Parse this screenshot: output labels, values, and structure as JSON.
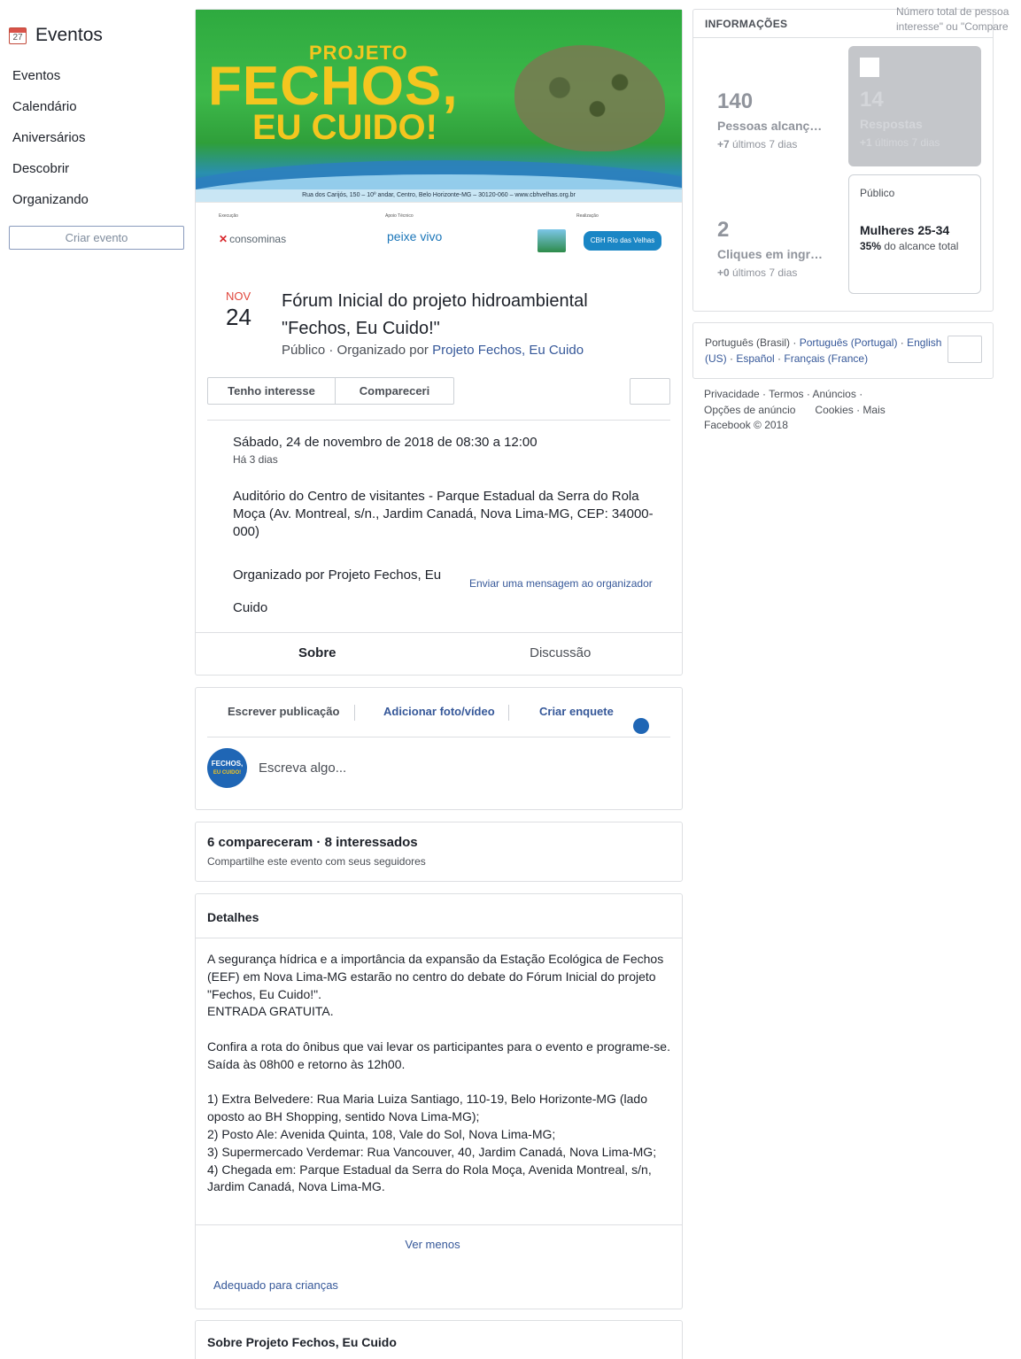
{
  "sidebar": {
    "title": "Eventos",
    "calendar_icon_day": "27",
    "nav": [
      "Eventos",
      "Calendário",
      "Aniversários",
      "Descobrir",
      "Organizando"
    ],
    "create_button": "Criar evento"
  },
  "cover": {
    "title_line1": "PROJETO",
    "title_line2": "FECHOS,",
    "title_line3": "EU CUIDO!",
    "address_strip": "Rua dos Carijós, 150 – 10º andar, Centro, Belo Horizonte-MG – 30120-060 – www.cbhvelhas.org.br",
    "logo_label_1": "Execução",
    "logo_label_2": "Apoio Técnico",
    "logo_label_3": "Realização",
    "logo_1": "consominas",
    "logo_2": "peixe vivo",
    "logo_4": "CBH Rio das Velhas"
  },
  "event": {
    "month": "NOV",
    "day": "24",
    "title": "Fórum Inicial do projeto hidroambiental \"Fechos, Eu Cuido!\"",
    "privacy": "Público · Organizado por",
    "organizer": "Projeto Fechos, Eu Cuido",
    "interested_button": "Tenho interesse",
    "attended_button": "Compareceri",
    "datetime": "Sábado, 24 de novembro de 2018 de 08:30 a 12:00",
    "relative_time": "Há 3 dias",
    "location": "Auditório do Centro de visitantes - Parque Estadual da Serra do Rola Moça (Av. Montreal, s/n., Jardim Canadá, Nova Lima-MG, CEP: 34000-000)",
    "organized_by_line1": "Organizado por Projeto Fechos, Eu",
    "organized_by_line2": "Cuido",
    "message_link": "Enviar uma mensagem ao organizador",
    "tab_about": "Sobre",
    "tab_discussion": "Discussão"
  },
  "composer": {
    "tab_write": "Escrever publicação",
    "tab_photo": "Adicionar foto/vídeo",
    "tab_poll": "Criar enquete",
    "placeholder": "Escreva algo...",
    "avatar_text1": "FECHOS,",
    "avatar_text2": "EU CUIDO!"
  },
  "attendance": {
    "summary": "6 compareceram · 8 interessados",
    "subtitle": "Compartilhe este evento com seus seguidores"
  },
  "details": {
    "heading": "Detalhes",
    "paragraph1": "A segurança hídrica e a importância da expansão da Estação Ecológica de Fechos (EEF) em Nova Lima-MG estarão no centro do debate do Fórum Inicial do projeto \"Fechos, Eu Cuido!\".",
    "paragraph1b": "ENTRADA GRATUITA.",
    "paragraph2": "Confira a rota do ônibus que vai levar os participantes para o evento e programe-se. Saída às 08h00 e retorno às 12h00.",
    "route1": "1) Extra Belvedere: Rua Maria Luiza Santiago, 110-19, Belo Horizonte-MG (lado oposto ao BH Shopping, sentido Nova Lima-MG);",
    "route2": "2) Posto Ale: Avenida Quinta, 108, Vale do Sol, Nova Lima-MG;",
    "route3": "3) Supermercado Verdemar: Rua Vancouver, 40, Jardim Canadá, Nova Lima-MG;",
    "route4": "4) Chegada em: Parque Estadual da Serra do Rola Moça, Avenida Montreal, s/n, Jardim Canadá, Nova Lima-MG.",
    "see_less": "Ver menos",
    "kids_link": "Adequado para crianças"
  },
  "about": {
    "heading": "Sobre Projeto Fechos, Eu Cuido"
  },
  "insights": {
    "heading": "INFORMAÇÕES",
    "tooltip_line1": "Número total de pessoa",
    "tooltip_line2": "interesse\" ou \"Compare",
    "reach_value": "140",
    "reach_label": "Pessoas alcançadas",
    "reach_delta": "+7",
    "reach_delta_label": "últimos 7 dias",
    "responses_value": "14",
    "responses_label": "Respostas",
    "responses_delta": "+1",
    "responses_delta_label": "últimos 7 dias",
    "clicks_value": "2",
    "clicks_label": "Cliques em ingressos",
    "clicks_delta": "+0",
    "clicks_delta_label": "últimos 7 dias",
    "audience_label": "Público",
    "audience_value": "Mulheres 25-34",
    "audience_pct": "35%",
    "audience_pct_label": "do alcance total"
  },
  "languages": {
    "current": "Português (Brasil)",
    "links": [
      "Português (Portugal)",
      "English (US)",
      "Español",
      "Français (France)"
    ]
  },
  "footer": {
    "line1": "Privacidade · Termos · Anúncios ·",
    "line2a": "Opções de anúncio",
    "line2b": "Cookies · Mais",
    "line3": "Facebook © 2018"
  },
  "colors": {
    "link": "#365899",
    "date_month": "#e0463c",
    "border": "#dddfe2",
    "cover_green": "#3db94a",
    "cover_yellow": "#f4c61f"
  }
}
